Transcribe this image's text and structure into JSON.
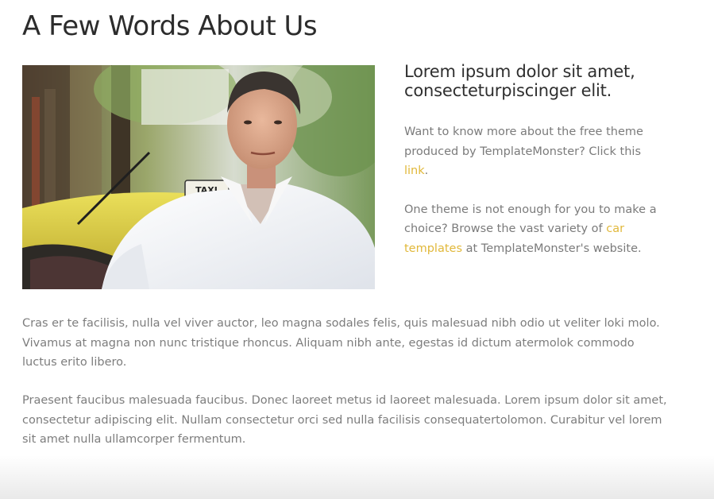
{
  "page": {
    "title": "A Few Words About Us"
  },
  "about": {
    "subheading": "Lorem ipsum dolor sit amet, consecteturpiscinger elit.",
    "para1_before": "Want to know more about the free theme produced by TemplateMonster? Click this ",
    "para1_link": "link",
    "para1_after": ".",
    "para2_before": "One theme is not enough for you to make a choice? Browse the vast variety of ",
    "para2_link": "car templates",
    "para2_after": " at TemplateMonster's website.",
    "photo_sign": "TAXI"
  },
  "body": {
    "paragraph1": "Cras er te facilisis, nulla vel viver auctor, leo magna sodales felis, quis malesuad nibh odio ut veliter loki molo. Vivamus at magna non nunc tristique rhoncus. Aliquam nibh ante, egestas id dictum atermolok commodo luctus erito libero.",
    "paragraph2": "Praesent faucibus malesuada faucibus. Donec laoreet metus id laoreet malesuada. Lorem ipsum dolor sit amet, consectetur adipiscing elit. Nullam consectetur orci sed nulla facilisis consequatertolomon. Curabitur vel lorem sit amet nulla ullamcorper fermentum."
  },
  "colors": {
    "accent": "#e1b83a",
    "heading": "#2c2c2c",
    "body_text": "#7d7d7d",
    "taxi_yellow": "#e8d548"
  }
}
